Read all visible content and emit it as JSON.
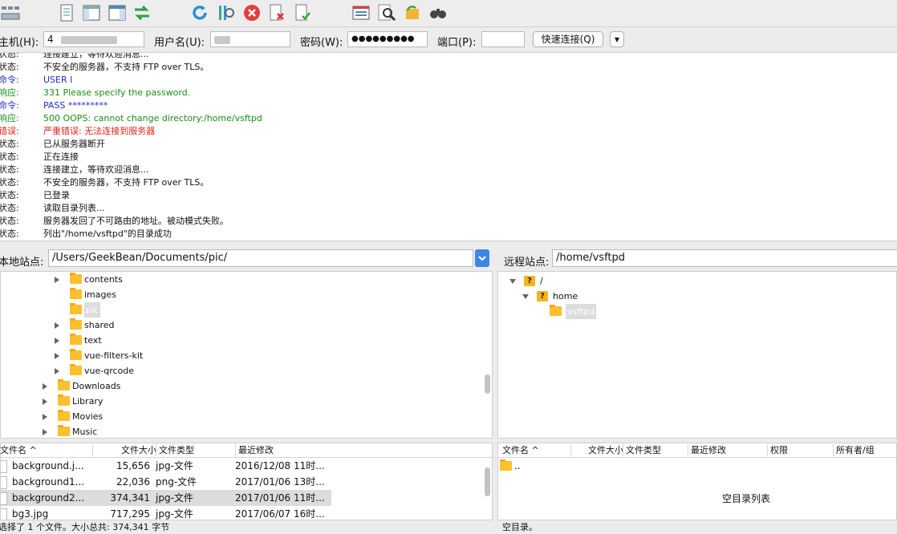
{
  "toolbar": {
    "icons": [
      "site-manager-icon",
      "message-log-icon",
      "local-tree-icon",
      "remote-tree-icon",
      "transfer-queue-icon",
      "refresh-icon",
      "process-queue-icon",
      "cancel-icon",
      "disconnect-icon",
      "reconnect-icon",
      "directory-listing-icon",
      "search-icon",
      "sync-browse-icon",
      "find-icon"
    ]
  },
  "quickconnect": {
    "host_label": "主机(H):",
    "host_value": "4",
    "user_label": "用户名(U):",
    "pass_label": "密码(W):",
    "pass_value": "●●●●●●●●●",
    "port_label": "端口(P):",
    "port_value": "",
    "connect_label": "快速连接(Q)",
    "dropdown_label": "▾"
  },
  "log": [
    {
      "type": "状态:",
      "msg": "连接建立，等待欢迎消息...",
      "kind": "status"
    },
    {
      "type": "状态:",
      "msg": "不安全的服务器，不支持 FTP over TLS。",
      "kind": "status"
    },
    {
      "type": "命令:",
      "msg": "USER I",
      "kind": "cmd"
    },
    {
      "type": "响应:",
      "msg": "331 Please specify the password.",
      "kind": "resp"
    },
    {
      "type": "命令:",
      "msg": "PASS *********",
      "kind": "cmd"
    },
    {
      "type": "响应:",
      "msg": "500 OOPS: cannot change directory:/home/vsftpd",
      "kind": "resp"
    },
    {
      "type": "错误:",
      "msg": "严重错误: 无法连接到服务器",
      "kind": "err"
    },
    {
      "type": "状态:",
      "msg": "已从服务器断开",
      "kind": "status"
    },
    {
      "type": "状态:",
      "msg": "正在连接",
      "kind": "status"
    },
    {
      "type": "状态:",
      "msg": "连接建立，等待欢迎消息...",
      "kind": "status"
    },
    {
      "type": "状态:",
      "msg": "不安全的服务器，不支持 FTP over TLS。",
      "kind": "status"
    },
    {
      "type": "状态:",
      "msg": "已登录",
      "kind": "status"
    },
    {
      "type": "状态:",
      "msg": "读取目录列表...",
      "kind": "status"
    },
    {
      "type": "状态:",
      "msg": "服务器发回了不可路由的地址。被动模式失败。",
      "kind": "status"
    },
    {
      "type": "状态:",
      "msg": "列出\"/home/vsftpd\"的目录成功",
      "kind": "status"
    }
  ],
  "local": {
    "label": "本地站点:",
    "path": "/Users/GeekBean/Documents/pic/",
    "tree": [
      {
        "name": "contents",
        "arrow": true
      },
      {
        "name": "images",
        "arrow": false
      },
      {
        "name": "pic",
        "arrow": false,
        "selected": true
      },
      {
        "name": "shared",
        "arrow": true
      },
      {
        "name": "text",
        "arrow": true
      },
      {
        "name": "vue-filters-kit",
        "arrow": true
      },
      {
        "name": "vue-qrcode",
        "arrow": true
      },
      {
        "name": "Downloads",
        "arrow": true
      },
      {
        "name": "Library",
        "arrow": true
      },
      {
        "name": "Movies",
        "arrow": true
      },
      {
        "name": "Music",
        "arrow": true
      }
    ],
    "columns": [
      "文件名 ^",
      "文件大小",
      "文件类型",
      "最近修改"
    ],
    "files": [
      {
        "name": "background.j...",
        "size": "15,656",
        "type": "jpg-文件",
        "modified": "2016/12/08 11时..."
      },
      {
        "name": "background1...",
        "size": "22,036",
        "type": "png-文件",
        "modified": "2017/01/06 13时..."
      },
      {
        "name": "background2...",
        "size": "374,341",
        "type": "jpg-文件",
        "modified": "2017/01/06 11时...",
        "selected": true
      },
      {
        "name": "bg3.jpg",
        "size": "717,295",
        "type": "jpg-文件",
        "modified": "2017/06/07 16时..."
      }
    ],
    "status": "选择了 1 个文件。大小总共: 374,341 字节"
  },
  "remote": {
    "label": "远程站点:",
    "path": "/home/vsftpd",
    "tree": [
      {
        "name": "/",
        "expanded": true,
        "unknown": true
      },
      {
        "name": "home",
        "expanded": true,
        "unknown": true
      },
      {
        "name": "vsftpd",
        "selected": true
      }
    ],
    "columns": [
      "文件名 ^",
      "文件大小",
      "文件类型",
      "最近修改",
      "权限",
      "所有者/组"
    ],
    "files": [
      {
        "name": ".."
      }
    ],
    "empty_text": "空目录列表",
    "status": "空目录。"
  }
}
